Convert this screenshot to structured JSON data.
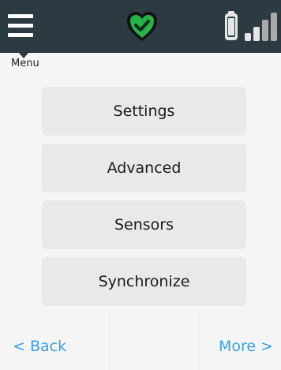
{
  "header": {
    "menu_label": "Menu",
    "status_icon": "heart-check-icon",
    "status_color": "#27b34a",
    "battery_icon": "battery-icon",
    "signal_icon": "signal-bars-icon"
  },
  "menu": {
    "items": [
      {
        "label": "Settings"
      },
      {
        "label": "Advanced"
      },
      {
        "label": "Sensors"
      },
      {
        "label": "Synchronize"
      }
    ]
  },
  "nav": {
    "back_label": "< Back",
    "more_label": "More >",
    "link_color": "#3aa0e6"
  }
}
